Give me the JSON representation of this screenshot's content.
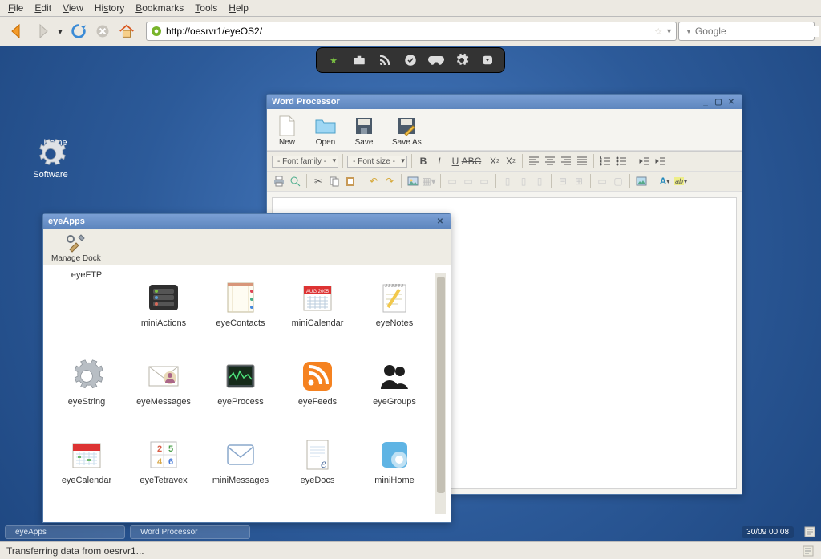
{
  "browser": {
    "menus": [
      "File",
      "Edit",
      "View",
      "History",
      "Bookmarks",
      "Tools",
      "Help"
    ],
    "url": "http://oesrvr1/eyeOS2/",
    "search_placeholder": "Google"
  },
  "desktop": {
    "icons": [
      {
        "label": "Home",
        "iconName": "home-icon"
      },
      {
        "label": "Software",
        "iconName": "gear-icon"
      }
    ],
    "dock_items": [
      "star",
      "briefcase",
      "rss",
      "check",
      "gamepad",
      "gear",
      "chevron-down"
    ],
    "taskbar": {
      "tasks": [
        "eyeApps",
        "Word Processor"
      ],
      "clock": "30/09  00:08"
    }
  },
  "wp": {
    "title": "Word Processor",
    "buttons": [
      {
        "label": "New",
        "iconName": "file-icon"
      },
      {
        "label": "Open",
        "iconName": "folder-icon"
      },
      {
        "label": "Save",
        "iconName": "save-icon"
      },
      {
        "label": "Save As",
        "iconName": "save-as-icon"
      }
    ],
    "fontfamily": "- Font family -",
    "fontsize": "- Font size -"
  },
  "apps": {
    "title": "eyeApps",
    "manage_label": "Manage Dock",
    "items": [
      {
        "label": "eyeFTP",
        "iconName": "ftp-icon"
      },
      {
        "label": "miniActions",
        "iconName": "actions-icon"
      },
      {
        "label": "eyeContacts",
        "iconName": "contacts-icon"
      },
      {
        "label": "miniCalendar",
        "iconName": "calendar-icon"
      },
      {
        "label": "eyeNotes",
        "iconName": "notes-icon"
      },
      {
        "label": "eyeString",
        "iconName": "string-gear-icon"
      },
      {
        "label": "eyeMessages",
        "iconName": "messages-icon"
      },
      {
        "label": "eyeProcess",
        "iconName": "process-icon"
      },
      {
        "label": "eyeFeeds",
        "iconName": "feeds-icon"
      },
      {
        "label": "eyeGroups",
        "iconName": "groups-icon"
      },
      {
        "label": "eyeCalendar",
        "iconName": "eyecalendar-icon"
      },
      {
        "label": "eyeTetravex",
        "iconName": "tetravex-icon"
      },
      {
        "label": "miniMessages",
        "iconName": "envelope-icon"
      },
      {
        "label": "eyeDocs",
        "iconName": "docs-icon"
      },
      {
        "label": "miniHome",
        "iconName": "minihome-icon"
      }
    ]
  },
  "status": "Transferring data from oesrvr1..."
}
